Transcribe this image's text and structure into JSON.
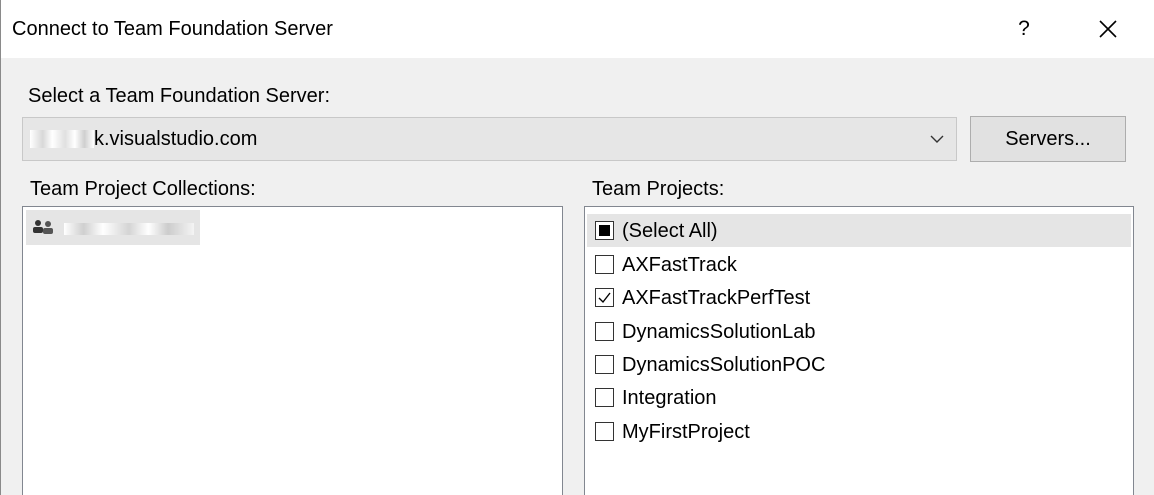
{
  "window": {
    "title": "Connect to Team Foundation Server",
    "help_label": "?"
  },
  "server": {
    "label": "Select a Team Foundation Server:",
    "selected_value": "k.visualstudio.com",
    "servers_button": "Servers..."
  },
  "collections": {
    "label": "Team Project Collections:",
    "items": [
      {
        "icon": "team-collection-icon",
        "name": "",
        "selected": true
      }
    ]
  },
  "projects": {
    "label": "Team Projects:",
    "items": [
      {
        "label": "(Select All)",
        "state": "indeterminate"
      },
      {
        "label": "AXFastTrack",
        "state": "unchecked"
      },
      {
        "label": "AXFastTrackPerfTest",
        "state": "checked"
      },
      {
        "label": "DynamicsSolutionLab",
        "state": "unchecked"
      },
      {
        "label": "DynamicsSolutionPOC",
        "state": "unchecked"
      },
      {
        "label": "Integration",
        "state": "unchecked"
      },
      {
        "label": "MyFirstProject",
        "state": "unchecked"
      }
    ]
  },
  "colors": {
    "dialog_background": "#f0f0f0",
    "titlebar_background": "#ffffff",
    "selection_background": "#e5e5e5"
  }
}
